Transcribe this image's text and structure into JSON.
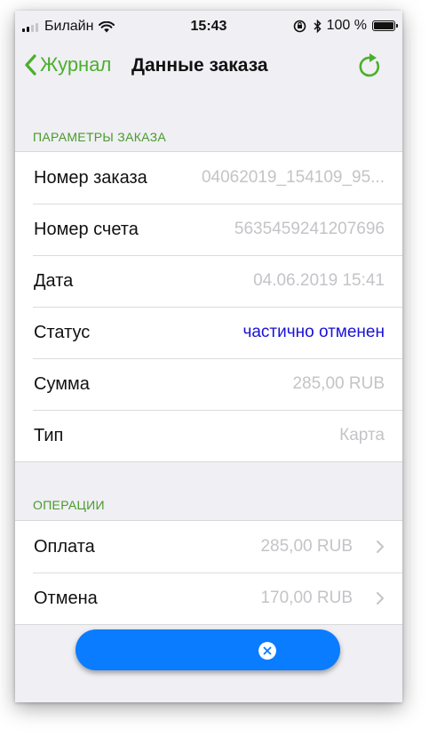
{
  "status_bar": {
    "carrier": "Билайн",
    "time": "15:43",
    "battery": "100 %",
    "battery_level": 1.0
  },
  "nav": {
    "back_label": "Журнал",
    "title": "Данные заказа"
  },
  "order_params": {
    "header": "ПАРАМЕТРЫ ЗАКАЗА",
    "rows": [
      {
        "label": "Номер заказа",
        "value": "04062019_154109_95..."
      },
      {
        "label": "Номер счета",
        "value": "5635459241207696"
      },
      {
        "label": "Дата",
        "value": "04.06.2019 15:41"
      },
      {
        "label": "Статус",
        "value": "частично отменен"
      },
      {
        "label": "Сумма",
        "value": "285,00 RUB"
      },
      {
        "label": "Тип",
        "value": "Карта"
      }
    ]
  },
  "operations": {
    "header": "ОПЕРАЦИИ",
    "rows": [
      {
        "label": "Оплата",
        "value": "285,00 RUB"
      },
      {
        "label": "Отмена",
        "value": "170,00 RUB"
      }
    ]
  },
  "colors": {
    "accent_green": "#4caf2a",
    "status_blue": "#1a12d6",
    "fab_blue": "#0a7cff"
  },
  "icons": {
    "back": "chevron-left-icon",
    "refresh": "refresh-icon",
    "row_disclosure": "chevron-right-icon",
    "fab": "close-circle-icon"
  }
}
